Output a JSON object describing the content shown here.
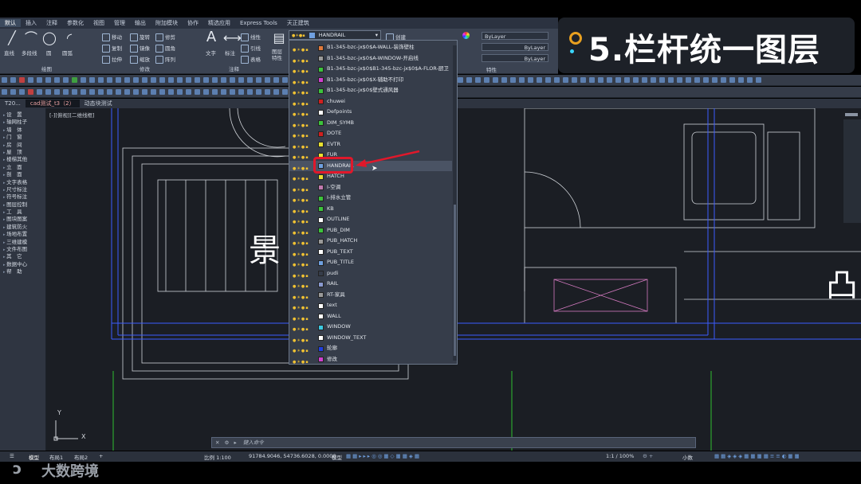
{
  "ribbon": {
    "tabs": [
      "默认",
      "插入",
      "注释",
      "参数化",
      "视图",
      "管理",
      "输出",
      "附加模块",
      "协作",
      "精选应用",
      "Express Tools",
      "天正建筑"
    ],
    "tools": {
      "line": "直线",
      "polyline": "多段线",
      "circle": "圆",
      "arc": "圆弧",
      "move": "移动",
      "rotate": "旋转",
      "trim": "修剪",
      "copy": "复制",
      "mirror": "镜像",
      "fillet": "圆角",
      "stretch": "拉伸",
      "scale": "缩放",
      "array": "阵列",
      "text": "文字",
      "dimension": "标注",
      "linear": "线性",
      "leader": "引线",
      "table": "表格",
      "layer_props": "图层特性",
      "create": "创建"
    },
    "groups": {
      "draw": "绘图",
      "modify": "修改",
      "annotation": "注释",
      "properties": "特性"
    },
    "properties": {
      "color": "ByLayer",
      "linetype": "ByLayer",
      "lineweight": "ByLayer"
    }
  },
  "overlay": {
    "title": "5.栏杆统一图层"
  },
  "doc_tabs": [
    "T20...",
    "cad测试_t3（2）",
    "动态块测试"
  ],
  "viewport_label": "[-][俯视][二维线框]",
  "left_panel": [
    "设　置",
    "轴网柱子",
    "墙　体",
    "门　窗",
    "房　间",
    "屋　顶",
    "楼梯其他",
    "立　面",
    "剖　面",
    "文字表格",
    "尺寸标注",
    "符号标注",
    "图层控制",
    "工　具",
    "图块图案",
    "建筑防火",
    "场地布置",
    "三维建模",
    "文件布图",
    "其　它",
    "数据中心",
    "帮　助"
  ],
  "layer_dropdown": {
    "current": "HANDRAIL",
    "layers": [
      {
        "name": "B1-345-bzc-jx$0$A-WALL-装饰壁柱",
        "color": "#e07a3c"
      },
      {
        "name": "B1-345-bzc-jx$0$A-WINDOW-开启线",
        "color": "#9a9a9a"
      },
      {
        "name": "B1-345-bzc-jx$0$B1-345-bzc-jx$0$A-FLOR-厨卫",
        "color": "#3cc43c"
      },
      {
        "name": "B1-345-bzc-jx$0$X-辅助不打印",
        "color": "#d040d0"
      },
      {
        "name": "B1-345-bzc-jx$0$壁式通风器",
        "color": "#3cc43c"
      },
      {
        "name": "chuwei",
        "color": "#d02020"
      },
      {
        "name": "Defpoints",
        "color": "#ffffff"
      },
      {
        "name": "DIM_SYMB",
        "color": "#3cc43c"
      },
      {
        "name": "DOTE",
        "color": "#d02020"
      },
      {
        "name": "EVTR",
        "color": "#e8e030"
      },
      {
        "name": "FUR",
        "color": "#e8e030"
      },
      {
        "name": "HANDRAIL",
        "color": "#6fa0e0"
      },
      {
        "name": "HATCH",
        "color": "#e8e030"
      },
      {
        "name": "I-空调",
        "color": "#c07ab0"
      },
      {
        "name": "I-排水立管",
        "color": "#3cc43c"
      },
      {
        "name": "KB",
        "color": "#3cc43c"
      },
      {
        "name": "OUTLINE",
        "color": "#ffffff"
      },
      {
        "name": "PUB_DIM",
        "color": "#3cc43c"
      },
      {
        "name": "PUB_HATCH",
        "color": "#9a9a9a"
      },
      {
        "name": "PUB_TEXT",
        "color": "#ffffff"
      },
      {
        "name": "PUB_TITLE",
        "color": "#6fa0e0"
      },
      {
        "name": "pudi",
        "color": "#363d4a"
      },
      {
        "name": "RAIL",
        "color": "#8a9ad0"
      },
      {
        "name": "RT-家具",
        "color": "#9a9a9a"
      },
      {
        "name": "text",
        "color": "#ffffff"
      },
      {
        "name": "WALL",
        "color": "#ffffff"
      },
      {
        "name": "WINDOW",
        "color": "#3cc8e0"
      },
      {
        "name": "WINDOW_TEXT",
        "color": "#ffffff"
      },
      {
        "name": "轮廓",
        "color": "#2040e0"
      },
      {
        "name": "修改",
        "color": "#d040d0"
      }
    ],
    "selected_index": 11
  },
  "canvas_text": {
    "big_label": "景",
    "right_label": "凸"
  },
  "axis": {
    "x": "X",
    "y": "Y"
  },
  "command": {
    "placeholder": "键入命令"
  },
  "layouts": [
    "模型",
    "布局1",
    "布局2"
  ],
  "status": {
    "scale": "比例 1:100",
    "coords": "91784.9046, 54736.6028, 0.0000",
    "model": "模型",
    "anno_scale": "1:1 / 100%",
    "units": "小数"
  },
  "watermark": "大数跨境"
}
